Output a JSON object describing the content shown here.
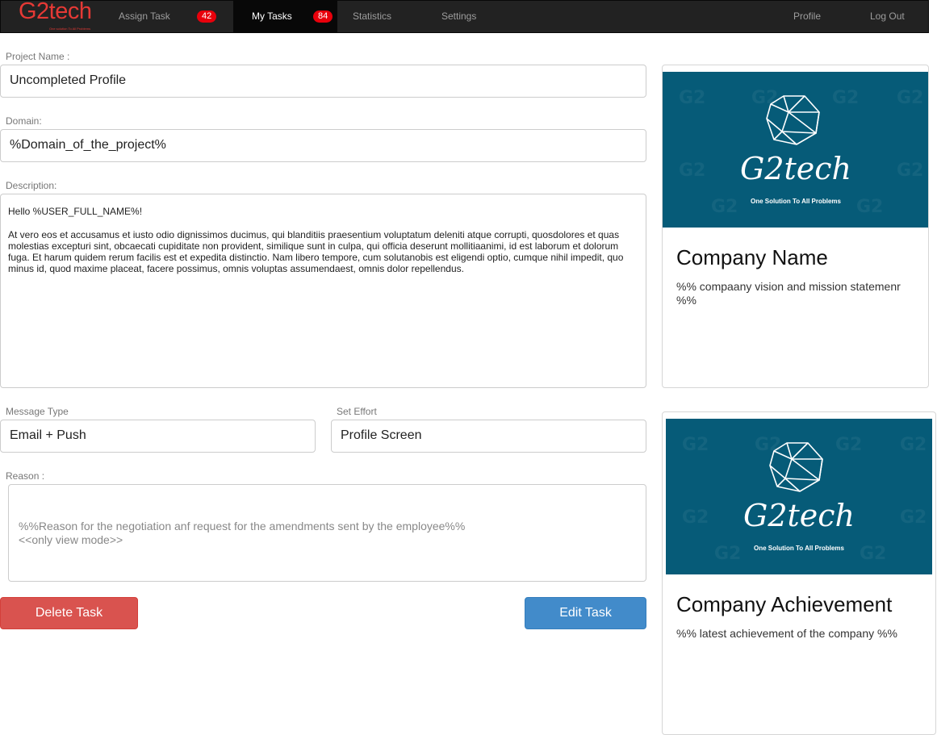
{
  "nav": {
    "brand": "G2tech",
    "brand_tagline": "One solution To All Problems",
    "items": [
      {
        "label": "Assign Task",
        "badge": "42"
      },
      {
        "label": "My Tasks",
        "badge": "84"
      },
      {
        "label": "Statistics"
      },
      {
        "label": "Settings"
      },
      {
        "label": "Profile"
      },
      {
        "label": "Log Out"
      }
    ]
  },
  "form": {
    "project_name_label": "Project Name :",
    "project_name_value": "Uncompleted Profile",
    "domain_label": "Domain:",
    "domain_value": "%Domain_of_the_project%",
    "description_label": "Description:",
    "description_greeting": "Hello %USER_FULL_NAME%!",
    "description_body": "At vero eos et accusamus et iusto odio dignissimos ducimus, qui blanditiis praesentium voluptatum deleniti atque corrupti, quosdolores et quas molestias excepturi sint, obcaecati cupiditate non provident, similique sunt in culpa, qui officia deserunt mollitiaanimi, id est laborum et dolorum fuga. Et harum quidem rerum facilis est et expedita distinctio. Nam libero tempore, cum solutanobis est eligendi optio, cumque nihil impedit, quo minus id, quod maxime placeat, facere possimus, omnis voluptas assumendaest, omnis dolor repellendus.",
    "message_type_label": "Message Type",
    "message_type_value": "Email + Push",
    "set_effort_label": "Set Effort",
    "set_effort_value": "Profile Screen",
    "reason_label": "Reason :",
    "reason_line1": "%%Reason for the negotiation anf request for the amendments sent by the employee%%",
    "reason_line2": "<<only view mode>>",
    "delete_button": "Delete Task",
    "edit_button": "Edit Task"
  },
  "cards": [
    {
      "logo_name": "G2tech",
      "logo_tagline": "One Solution To All Problems",
      "title": "Company Name",
      "text": "%% compaany vision and mission statemenr %%"
    },
    {
      "logo_name": "G2tech",
      "logo_tagline": "One Solution To All Problems",
      "title": "Company Achievement",
      "text": "%% latest achievement of the company %%"
    }
  ],
  "colors": {
    "navbar_bg": "#222222",
    "brand_red": "#e53935",
    "badge_red": "#e8000b",
    "danger": "#d9534f",
    "primary": "#428bca",
    "card_image_teal": "#065b78"
  }
}
